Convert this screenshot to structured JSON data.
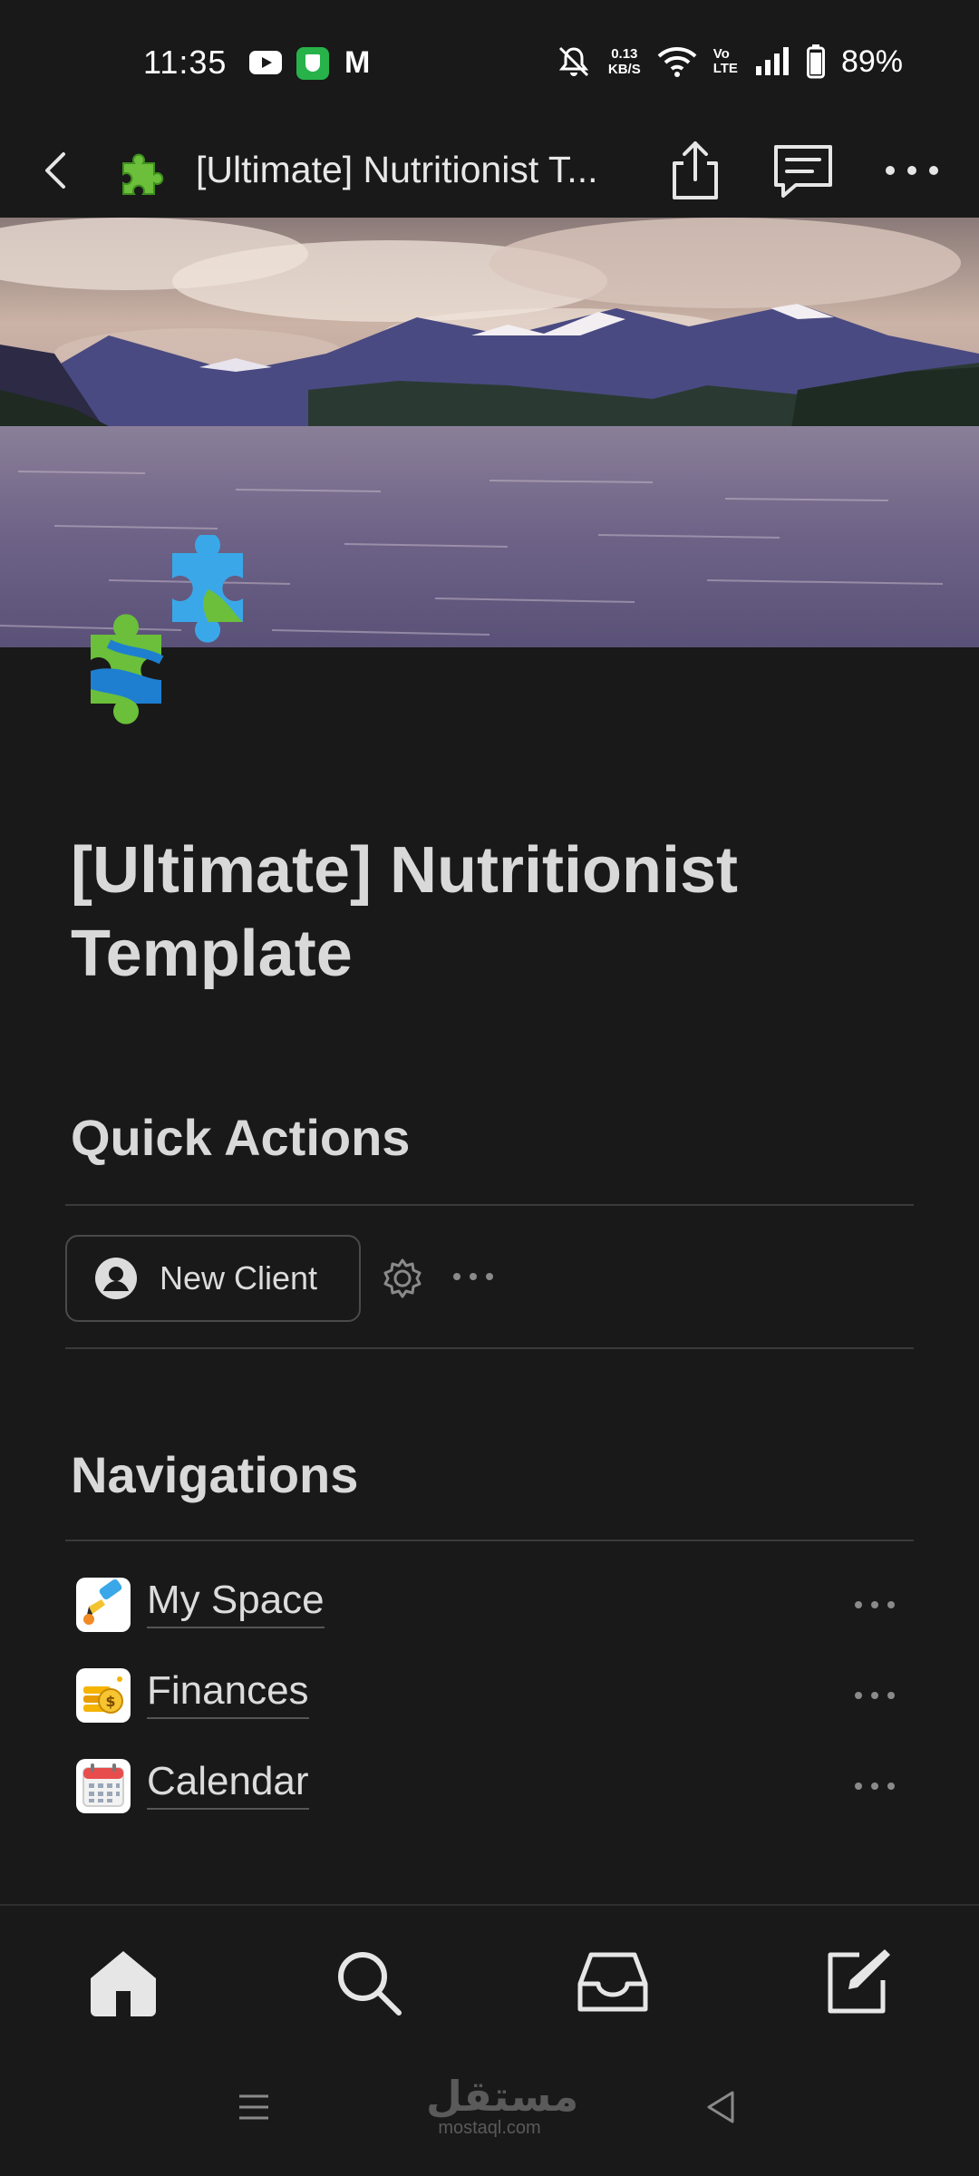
{
  "status_bar": {
    "time": "11:35",
    "gmail": "M",
    "net_speed_value": "0.13",
    "net_speed_unit": "KB/S",
    "volte_top": "Vo",
    "volte_bottom": "LTE",
    "battery": "89%"
  },
  "header": {
    "title": "[Ultimate] Nutritionist T..."
  },
  "page": {
    "title": "[Ultimate] Nutritionist Template"
  },
  "quick_actions": {
    "heading": "Quick Actions",
    "new_client_label": "New Client"
  },
  "navigations": {
    "heading": "Navigations",
    "items": [
      {
        "label": "My Space",
        "icon": "pen-icon"
      },
      {
        "label": "Finances",
        "icon": "coins-icon"
      },
      {
        "label": "Calendar",
        "icon": "calendar-icon"
      }
    ]
  },
  "bottom_bar": {
    "items": [
      "home-icon",
      "search-icon",
      "inbox-icon",
      "compose-icon"
    ]
  },
  "watermark": {
    "arabic": "مستقل",
    "latin": "mostaql.com"
  },
  "colors": {
    "background": "#191919",
    "text": "#d9d9d9",
    "divider": "#3a3a3a"
  }
}
